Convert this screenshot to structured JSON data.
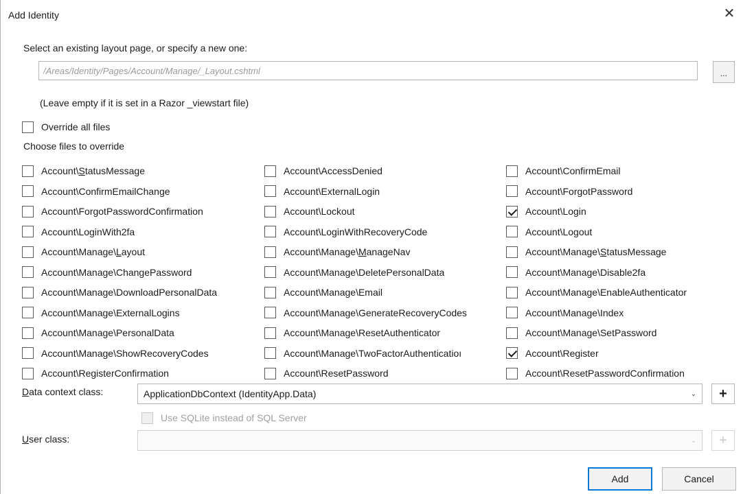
{
  "dialog": {
    "title": "Add Identity",
    "close_glyph": "✕"
  },
  "layout": {
    "prompt": "Select an existing layout page, or specify a new one:",
    "placeholder": "/Areas/Identity/Pages/Account/Manage/_Layout.cshtml",
    "value": "",
    "browse_label": "...",
    "hint": "(Leave empty if it is set in a Razor _viewstart file)"
  },
  "override_all": {
    "label": "Override all files",
    "checked": false
  },
  "choose_label": "Choose files to override",
  "files": {
    "col1": [
      {
        "pre": "Account\\",
        "u": "S",
        "post": "tatusMessage",
        "checked": false
      },
      {
        "pre": "Account\\ConfirmEmailChange",
        "u": "",
        "post": "",
        "checked": false
      },
      {
        "pre": "Account\\ForgotPasswordConfirmation",
        "u": "",
        "post": "",
        "checked": false
      },
      {
        "pre": "Account\\LoginWith2fa",
        "u": "",
        "post": "",
        "checked": false
      },
      {
        "pre": "Account\\Manage\\",
        "u": "L",
        "post": "ayout",
        "checked": false
      },
      {
        "pre": "Account\\Manage\\ChangePassword",
        "u": "",
        "post": "",
        "checked": false
      },
      {
        "pre": "Account\\Manage\\DownloadPersonalData",
        "u": "",
        "post": "",
        "checked": false
      },
      {
        "pre": "Account\\Manage\\ExternalLogins",
        "u": "",
        "post": "",
        "checked": false
      },
      {
        "pre": "Account\\Manage\\PersonalData",
        "u": "",
        "post": "",
        "checked": false
      },
      {
        "pre": "Account\\Manage\\ShowRecoveryCodes",
        "u": "",
        "post": "",
        "checked": false
      },
      {
        "pre": "Account\\RegisterConfirmation",
        "u": "",
        "post": "",
        "checked": false
      }
    ],
    "col2": [
      {
        "pre": "Account\\AccessDenied",
        "u": "",
        "post": "",
        "checked": false
      },
      {
        "pre": "Account\\ExternalLogin",
        "u": "",
        "post": "",
        "checked": false
      },
      {
        "pre": "Account\\Lockout",
        "u": "",
        "post": "",
        "checked": false
      },
      {
        "pre": "Account\\LoginWithRecoveryCode",
        "u": "",
        "post": "",
        "checked": false
      },
      {
        "pre": "Account\\Manage\\",
        "u": "M",
        "post": "anageNav",
        "checked": false
      },
      {
        "pre": "Account\\Manage\\DeletePersonalData",
        "u": "",
        "post": "",
        "checked": false
      },
      {
        "pre": "Account\\Manage\\Email",
        "u": "",
        "post": "",
        "checked": false
      },
      {
        "pre": "Account\\Manage\\GenerateRecoveryCodes",
        "u": "",
        "post": "",
        "checked": false
      },
      {
        "pre": "Account\\Manage\\ResetAuthenticator",
        "u": "",
        "post": "",
        "checked": false
      },
      {
        "pre": "Account\\Manage\\TwoFactorAuthenticatioı",
        "u": "",
        "post": "",
        "checked": false
      },
      {
        "pre": "Account\\ResetPassword",
        "u": "",
        "post": "",
        "checked": false
      }
    ],
    "col3": [
      {
        "pre": "Account\\ConfirmEmail",
        "u": "",
        "post": "",
        "checked": false
      },
      {
        "pre": "Account\\ForgotPassword",
        "u": "",
        "post": "",
        "checked": false
      },
      {
        "pre": "Account\\Login",
        "u": "",
        "post": "",
        "checked": true
      },
      {
        "pre": "Account\\Logout",
        "u": "",
        "post": "",
        "checked": false
      },
      {
        "pre": "Account\\Manage\\",
        "u": "S",
        "post": "tatusMessage",
        "checked": false
      },
      {
        "pre": "Account\\Manage\\Disable2fa",
        "u": "",
        "post": "",
        "checked": false
      },
      {
        "pre": "Account\\Manage\\EnableAuthenticator",
        "u": "",
        "post": "",
        "checked": false
      },
      {
        "pre": "Account\\Manage\\Index",
        "u": "",
        "post": "",
        "checked": false
      },
      {
        "pre": "Account\\Manage\\SetPassword",
        "u": "",
        "post": "",
        "checked": false
      },
      {
        "pre": "Account\\Register",
        "u": "",
        "post": "",
        "checked": true
      },
      {
        "pre": "Account\\ResetPasswordConfirmation",
        "u": "",
        "post": "",
        "checked": false
      }
    ]
  },
  "data_context": {
    "label_u": "D",
    "label_rest": "ata context class:",
    "value": "ApplicationDbContext (IdentityApp.Data)",
    "arrow": "⌄",
    "add": "+"
  },
  "sqlite": {
    "label": "Use SQLite instead of SQL Server",
    "checked": false,
    "enabled": false
  },
  "user_class": {
    "label_u": "U",
    "label_rest": "ser class:",
    "value": "",
    "arrow": "⌄",
    "add": "+"
  },
  "buttons": {
    "add": "Add",
    "cancel": "Cancel"
  }
}
